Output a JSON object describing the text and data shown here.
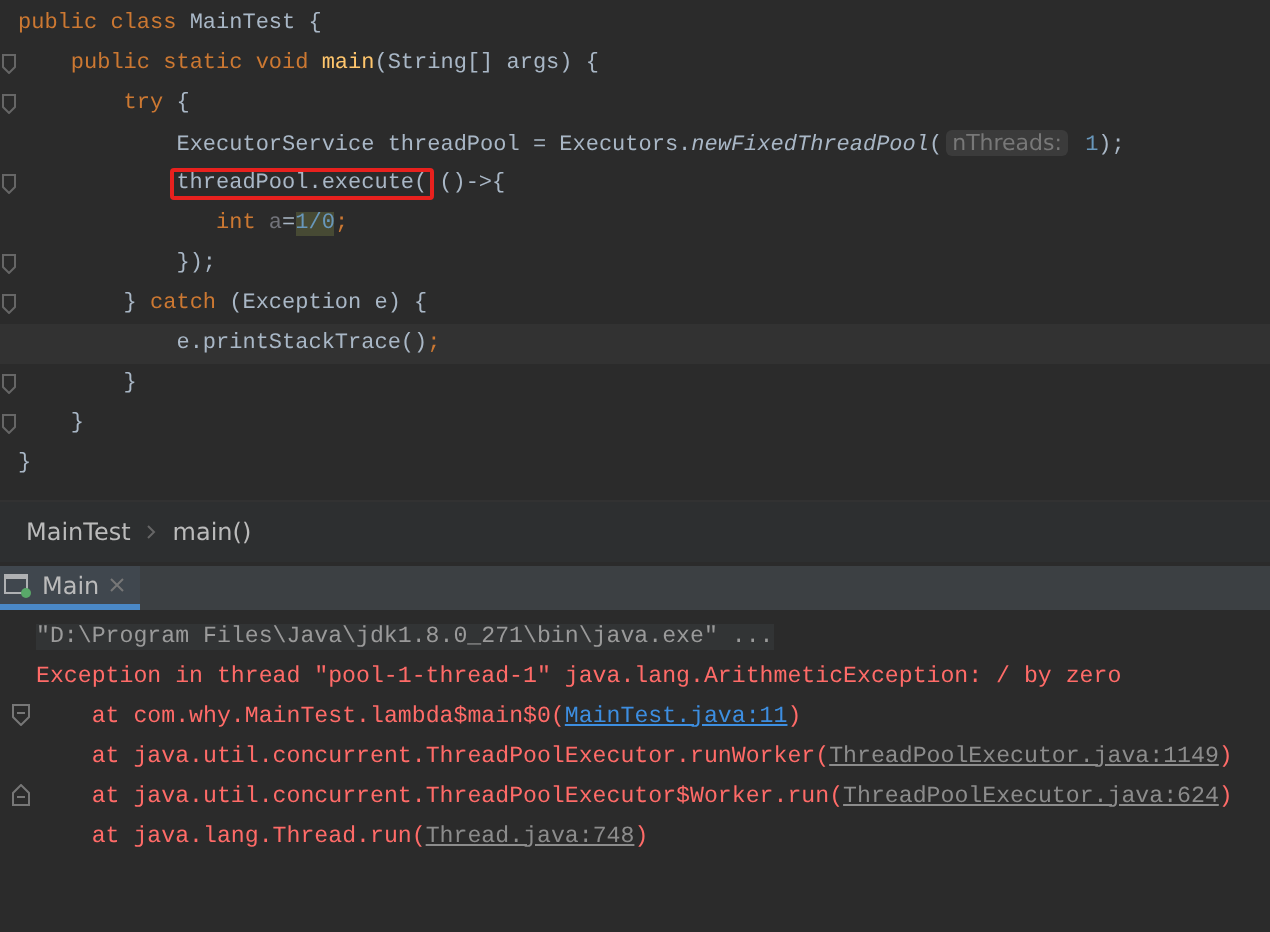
{
  "editor": {
    "lines": [
      {
        "fold": false,
        "current": false,
        "tokens": [
          {
            "kind": "keyword",
            "text": "public class "
          },
          {
            "kind": "text",
            "text": "MainTest {"
          }
        ]
      },
      {
        "fold": true,
        "current": false,
        "tokens": [
          {
            "kind": "keyword",
            "text": "    public static void "
          },
          {
            "kind": "method-decl",
            "text": "main"
          },
          {
            "kind": "text",
            "text": "(String[] args) {"
          }
        ]
      },
      {
        "fold": true,
        "current": false,
        "tokens": [
          {
            "kind": "keyword",
            "text": "        try "
          },
          {
            "kind": "text",
            "text": "{"
          }
        ]
      },
      {
        "fold": false,
        "current": false,
        "tokens": [
          {
            "kind": "text",
            "text": "            ExecutorService threadPool = Executors."
          },
          {
            "kind": "static-call",
            "text": "newFixedThreadPool"
          },
          {
            "kind": "text",
            "text": "("
          },
          {
            "kind": "param-hint",
            "text": "nThreads:"
          },
          {
            "kind": "number",
            "text": " 1"
          },
          {
            "kind": "text",
            "text": ");"
          }
        ]
      },
      {
        "fold": true,
        "current": false,
        "tokens": [
          {
            "kind": "boxed",
            "text": "threadPool.execute("
          },
          {
            "kind": "text",
            "text": "()->{"
          }
        ]
      },
      {
        "fold": false,
        "current": false,
        "tokens": [
          {
            "kind": "keyword",
            "text": "               int "
          },
          {
            "kind": "unused",
            "text": "a"
          },
          {
            "kind": "text",
            "text": "="
          },
          {
            "kind": "warning",
            "text": "1/0"
          },
          {
            "kind": "keyword",
            "text": ";"
          }
        ]
      },
      {
        "fold": true,
        "current": false,
        "tokens": [
          {
            "kind": "text",
            "text": "            });"
          }
        ]
      },
      {
        "fold": true,
        "current": false,
        "tokens": [
          {
            "kind": "text",
            "text": "        } "
          },
          {
            "kind": "keyword",
            "text": "catch "
          },
          {
            "kind": "text",
            "text": "(Exception e) {"
          }
        ]
      },
      {
        "fold": false,
        "current": true,
        "tokens": [
          {
            "kind": "text",
            "text": "            e.printStackTrace()"
          },
          {
            "kind": "keyword",
            "text": ";"
          }
        ]
      },
      {
        "fold": true,
        "current": false,
        "tokens": [
          {
            "kind": "text",
            "text": "        }"
          }
        ]
      },
      {
        "fold": true,
        "current": false,
        "tokens": [
          {
            "kind": "text",
            "text": "    }"
          }
        ]
      },
      {
        "fold": false,
        "current": false,
        "tokens": [
          {
            "kind": "text",
            "text": "}"
          }
        ]
      }
    ]
  },
  "breadcrumb": [
    "MainTest",
    "main()"
  ],
  "run_tabs": [
    {
      "label": "Main",
      "selected": true
    }
  ],
  "console": [
    {
      "kind": "command",
      "text": "\"D:\\Program Files\\Java\\jdk1.8.0_271\\bin\\java.exe\" ..."
    },
    {
      "kind": "error",
      "text": "Exception in thread \"pool-1-thread-1\" java.lang.ArithmeticException: / by zero"
    },
    {
      "kind": "trace",
      "fold_start": true,
      "text": "at com.why.MainTest.lambda$main$0(",
      "link": "MainTest.java:11",
      "link_active": true,
      "suffix": ")"
    },
    {
      "kind": "trace",
      "text": "at java.util.concurrent.ThreadPoolExecutor.runWorker(",
      "link": "ThreadPoolExecutor.java:1149",
      "link_active": false,
      "suffix": ")"
    },
    {
      "kind": "trace",
      "fold_end": true,
      "text": "at java.util.concurrent.ThreadPoolExecutor$Worker.run(",
      "link": "ThreadPoolExecutor.java:624",
      "link_active": false,
      "suffix": ")"
    },
    {
      "kind": "trace",
      "text": "at java.lang.Thread.run(",
      "link": "Thread.java:748",
      "link_active": false,
      "suffix": ")"
    }
  ]
}
